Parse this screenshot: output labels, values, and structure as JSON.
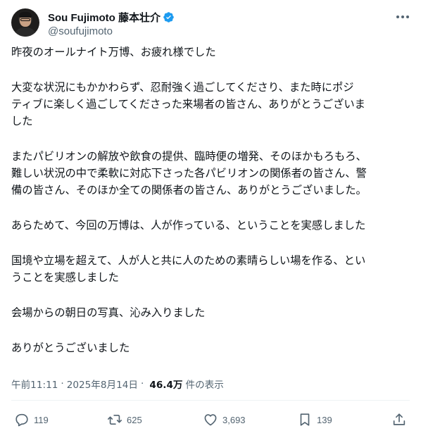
{
  "author": {
    "display_name": "Sou Fujimoto 藤本壮介",
    "handle": "@soufujimoto",
    "verified_icon": "verified-badge-icon",
    "badge_color": "#1d9bf0"
  },
  "tweet": {
    "paragraphs": [
      "昨夜のオールナイト万博、お疲れ様でした",
      "大変な状況にもかかわらず、忍耐強く過ごしてくださり、また時にポジ\nティブに楽しく過ごしてくださった来場者の皆さん、ありがとうございま\nした",
      "またパビリオンの解放や飲食の提供、臨時便の増発、そのほかもろもろ、\n難しい状況の中で柔軟に対応下さった各パビリオンの関係者の皆さん、警\n備の皆さん、そのほか全ての関係者の皆さん、ありがとうございました。",
      "あらためて、今回の万博は、人が作っている、ということを実感しました",
      "国境や立場を超えて、人が人と共に人のための素晴らしい場を作る、とい\nうことを実感しました",
      "会場からの朝日の写真、沁み入りました",
      "ありがとうございました"
    ]
  },
  "meta": {
    "time": "午前11:11",
    "separator": "·",
    "date": "2025年8月14日",
    "views": "46.4万",
    "views_label": "件の表示"
  },
  "actions": {
    "reply_count": "119",
    "repost_count": "625",
    "like_count": "3,693",
    "bookmark_count": "139"
  },
  "colors": {
    "text": "#0f1419",
    "secondary": "#536471",
    "divider": "#eff3f4"
  }
}
